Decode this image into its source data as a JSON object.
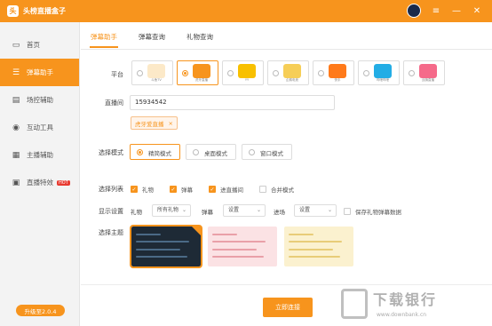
{
  "app": {
    "title": "头榜直播盒子",
    "logo_glyph": "头"
  },
  "titlebar": {
    "menu_icon": "≡",
    "minimize_icon": "—",
    "close_icon": "✕"
  },
  "sidebar": {
    "items": [
      {
        "label": "首页",
        "icon": "monitor-icon",
        "glyph": "▭"
      },
      {
        "label": "弹幕助手",
        "icon": "chat-icon",
        "glyph": "☰"
      },
      {
        "label": "场控辅助",
        "icon": "clipboard-icon",
        "glyph": "▤"
      },
      {
        "label": "互动工具",
        "icon": "globe-icon",
        "glyph": "◉"
      },
      {
        "label": "主播辅助",
        "icon": "grid-icon",
        "glyph": "▦"
      },
      {
        "label": "直播特效",
        "icon": "camera-icon",
        "glyph": "▣",
        "badge": "HOT"
      }
    ],
    "upgrade_label": "升级至2.0.4"
  },
  "tabs": [
    {
      "label": "弹幕助手"
    },
    {
      "label": "弹幕查询"
    },
    {
      "label": "礼物查询"
    }
  ],
  "form": {
    "platform_label": "平台",
    "platforms": [
      {
        "name": "斗鱼TV",
        "color": "#f5a623"
      },
      {
        "name": "虎牙直播",
        "color": "#f7941d"
      },
      {
        "name": "YY",
        "color": "#f8c000"
      },
      {
        "name": "企鹅电竞",
        "color": "#f2b90f"
      },
      {
        "name": "快手",
        "color": "#ff7a1a"
      },
      {
        "name": "哔哩哔哩",
        "color": "#23ade5"
      },
      {
        "name": "战旗直播",
        "color": "#f56a8a"
      }
    ],
    "room_label": "直播间",
    "room_value": "15934542",
    "room_tag": "虎牙爱直播",
    "room_tag_close": "×",
    "mode_label": "选择模式",
    "modes": [
      "精简模式",
      "桌面模式",
      "窗口模式"
    ],
    "list_label": "选择列表",
    "list_items": [
      {
        "label": "礼物",
        "checked": true
      },
      {
        "label": "弹幕",
        "checked": true
      },
      {
        "label": "进直播间",
        "checked": true
      },
      {
        "label": "合并模式",
        "checked": false
      }
    ],
    "display_label": "显示设置",
    "gift_label": "礼物",
    "gift_select": "所有礼物",
    "danmu_label": "弹幕",
    "danmu_select": "设置",
    "enter_label": "进场",
    "enter_select": "设置",
    "save_data_label": "保存礼物弹幕数据",
    "save_data_checked": false,
    "theme_label": "选择主题",
    "themes": [
      {
        "bg": "#1e2a36",
        "line": "#4b6a86",
        "accent": "#f7941d"
      },
      {
        "bg": "#fbe2e4",
        "line": "#e9a0a8",
        "accent": "#f4b8bf"
      },
      {
        "bg": "#fbf1cf",
        "line": "#e8cc78",
        "accent": "#f1d98f"
      }
    ]
  },
  "connect_button": "立即连接",
  "watermark": {
    "title": "下载银行",
    "url": "www.downbank.cn"
  }
}
